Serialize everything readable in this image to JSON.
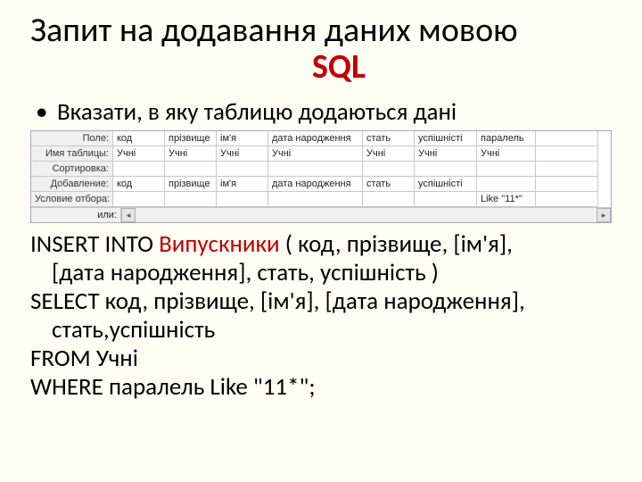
{
  "title_main": "Запит на додавання даних мовою",
  "title_sql": "SQL",
  "bullet_dot": "•",
  "bullet_text": "Вказати, в яку таблицю додаються дані",
  "grid": {
    "row_labels": [
      "Поле:",
      "Имя таблицы:",
      "Сортировка:",
      "Добавление:",
      "Условие отбора:",
      "или:"
    ],
    "cols": {
      "c1": {
        "field": "код",
        "table": "Учні",
        "add": "код",
        "crit": ""
      },
      "c2": {
        "field": "прізвище",
        "table": "Учні",
        "add": "прізвище",
        "crit": ""
      },
      "c3": {
        "field": "ім'я",
        "table": "Учні",
        "add": "ім'я",
        "crit": ""
      },
      "c4": {
        "field": "дата народження",
        "table": "Учні",
        "add": "дата народження",
        "crit": ""
      },
      "c5": {
        "field": "стать",
        "table": "Учні",
        "add": "стать",
        "crit": ""
      },
      "c6": {
        "field": "успішністі",
        "table": "Учні",
        "add": "успішністі",
        "crit": ""
      },
      "c7": {
        "field": "паралель",
        "table": "Учні",
        "add": "",
        "crit": "Like \"11*\""
      },
      "c8": {
        "field": "",
        "table": "",
        "add": "",
        "crit": ""
      }
    },
    "scroll_left": "◂",
    "scroll_right": "▸"
  },
  "sql": {
    "l1a": "INSERT INTO ",
    "l1b": "Випускники",
    "l1c": " ( код, прізвище, [ім'я],",
    "l2": "[дата народження], стать, успішність )",
    "l3": "SELECT код, прізвище, [ім'я], [дата народження],",
    "l4": "стать,успішність",
    "l5": "FROM Учні",
    "l6": "WHERE паралель Like \"11*\";"
  }
}
